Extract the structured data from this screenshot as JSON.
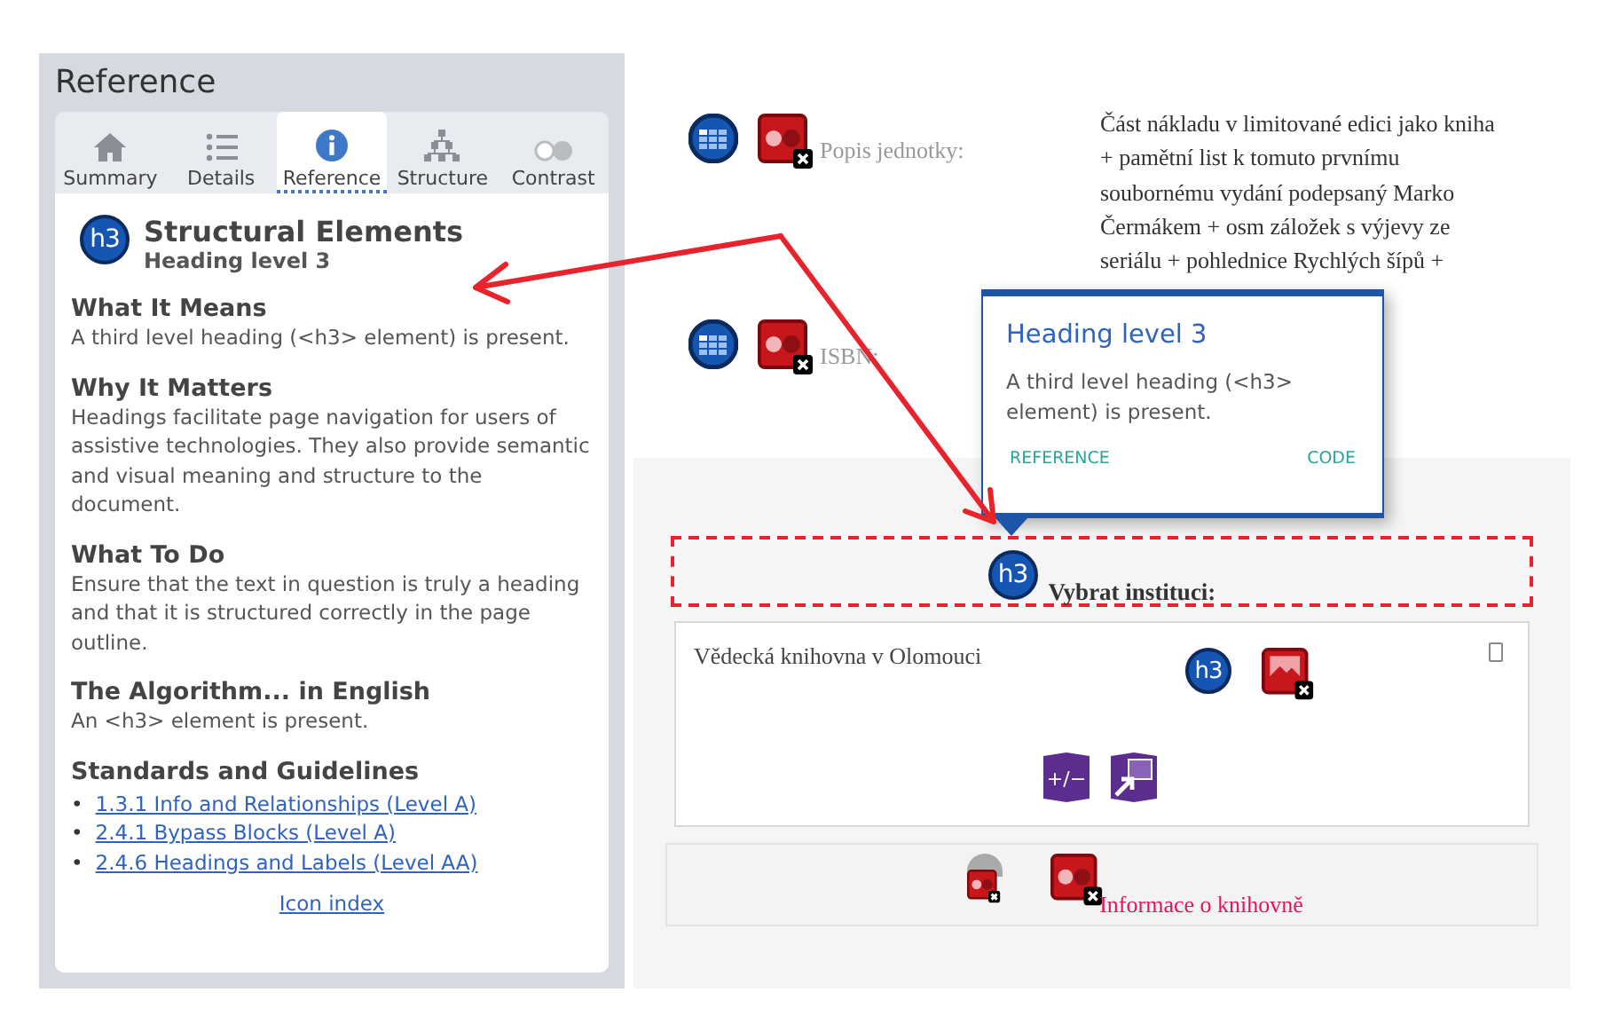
{
  "panel": {
    "title": "Reference",
    "tabs": [
      {
        "label": "Summary",
        "selected": false
      },
      {
        "label": "Details",
        "selected": false
      },
      {
        "label": "Reference",
        "selected": true
      },
      {
        "label": "Structure",
        "selected": false
      },
      {
        "label": "Contrast",
        "selected": false
      }
    ],
    "heading": {
      "badge": "h3",
      "title": "Structural Elements",
      "subtitle": "Heading level 3"
    },
    "sections": [
      {
        "title": "What It Means",
        "text": "A third level heading (<h3> element) is present."
      },
      {
        "title": "Why It Matters",
        "text": "Headings facilitate page navigation for users of assistive technologies. They also provide semantic and visual meaning and structure to the document."
      },
      {
        "title": "What To Do",
        "text": "Ensure that the text in question is truly a heading and that it is structured correctly in the page outline."
      },
      {
        "title": "The Algorithm... in English",
        "text": "An <h3> element is present."
      }
    ],
    "standards": {
      "title": "Standards and Guidelines",
      "links": [
        {
          "marker": "•",
          "label": "1.3.1 Info and Relationships (Level A)"
        },
        {
          "marker": "•",
          "label": "2.4.1 Bypass Blocks (Level A)"
        },
        {
          "marker": "•",
          "label": "2.4.6 Headings and Labels (Level AA)"
        }
      ]
    },
    "footer_link": "Icon index"
  },
  "page": {
    "fields": [
      {
        "label": "Popis jednotky:",
        "value": "Část nákladu v limitované edici jako kniha + pamětní list k tomuto prvnímu soubornému vydání podepsaný Marko Čermákem + osm záložek s výjevy ze seriálu + pohlednice Rychlých šípů +"
      },
      {
        "label": "ISBN:"
      }
    ],
    "heading": {
      "badge": "h3",
      "text": "Vybrat instituci:"
    },
    "institution": {
      "name": "Vědecká knihovna v Olomouci",
      "badge": "h3",
      "tool_label": "+/−"
    },
    "info_link": "Informace o knihovně"
  },
  "tooltip": {
    "title": "Heading level 3",
    "text": "A third level heading (<h3> element) is present.",
    "actions": [
      "REFERENCE",
      "CODE"
    ]
  }
}
